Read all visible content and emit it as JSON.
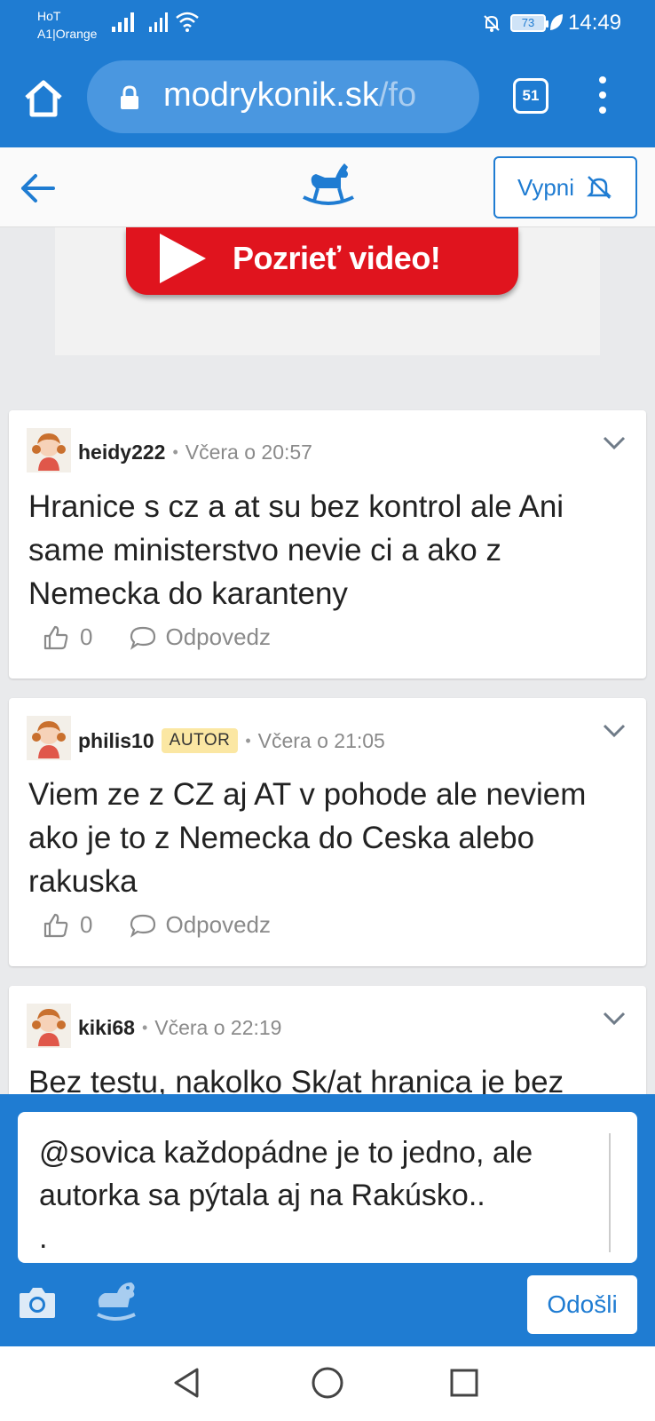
{
  "status_bar": {
    "carrier_line1": "HoT",
    "carrier_line2": "A1|Orange",
    "battery": "73",
    "time": "14:49"
  },
  "browser": {
    "url_main": "modrykonik.sk",
    "url_rest": "/fo",
    "tab_count": "51"
  },
  "header": {
    "mute_button": "Vypni"
  },
  "ad": {
    "button_text": "Pozrieť video!"
  },
  "comments": [
    {
      "username": "heidy222",
      "badge": "",
      "time": "Včera o 20:57",
      "text": "Hranice s cz a at su bez kontrol ale Ani same ministerstvo nevie ci a ako z Nemecka do karanteny",
      "likes": "0",
      "reply_label": "Odpovedz"
    },
    {
      "username": "philis10",
      "badge": "AUTOR",
      "time": "Včera o 21:05",
      "text": "Viem ze z CZ aj AT v pohode ale neviem ako je to z Nemecka do Ceska alebo rakuska",
      "likes": "0",
      "reply_label": "Odpovedz"
    },
    {
      "username": "kiki68",
      "badge": "",
      "time": "Včera o 22:19",
      "text": "Bez testu, nakolko Sk/at hranica je bez"
    }
  ],
  "composer": {
    "text": "@sovica každopádne je to jedno, ale autorka sa pýtala aj na Rakúsko..\n.",
    "send_label": "Odošli"
  },
  "colors": {
    "brand_blue": "#1f7cd2",
    "ad_red": "#e0141e",
    "badge_bg": "#fbe7a3"
  }
}
